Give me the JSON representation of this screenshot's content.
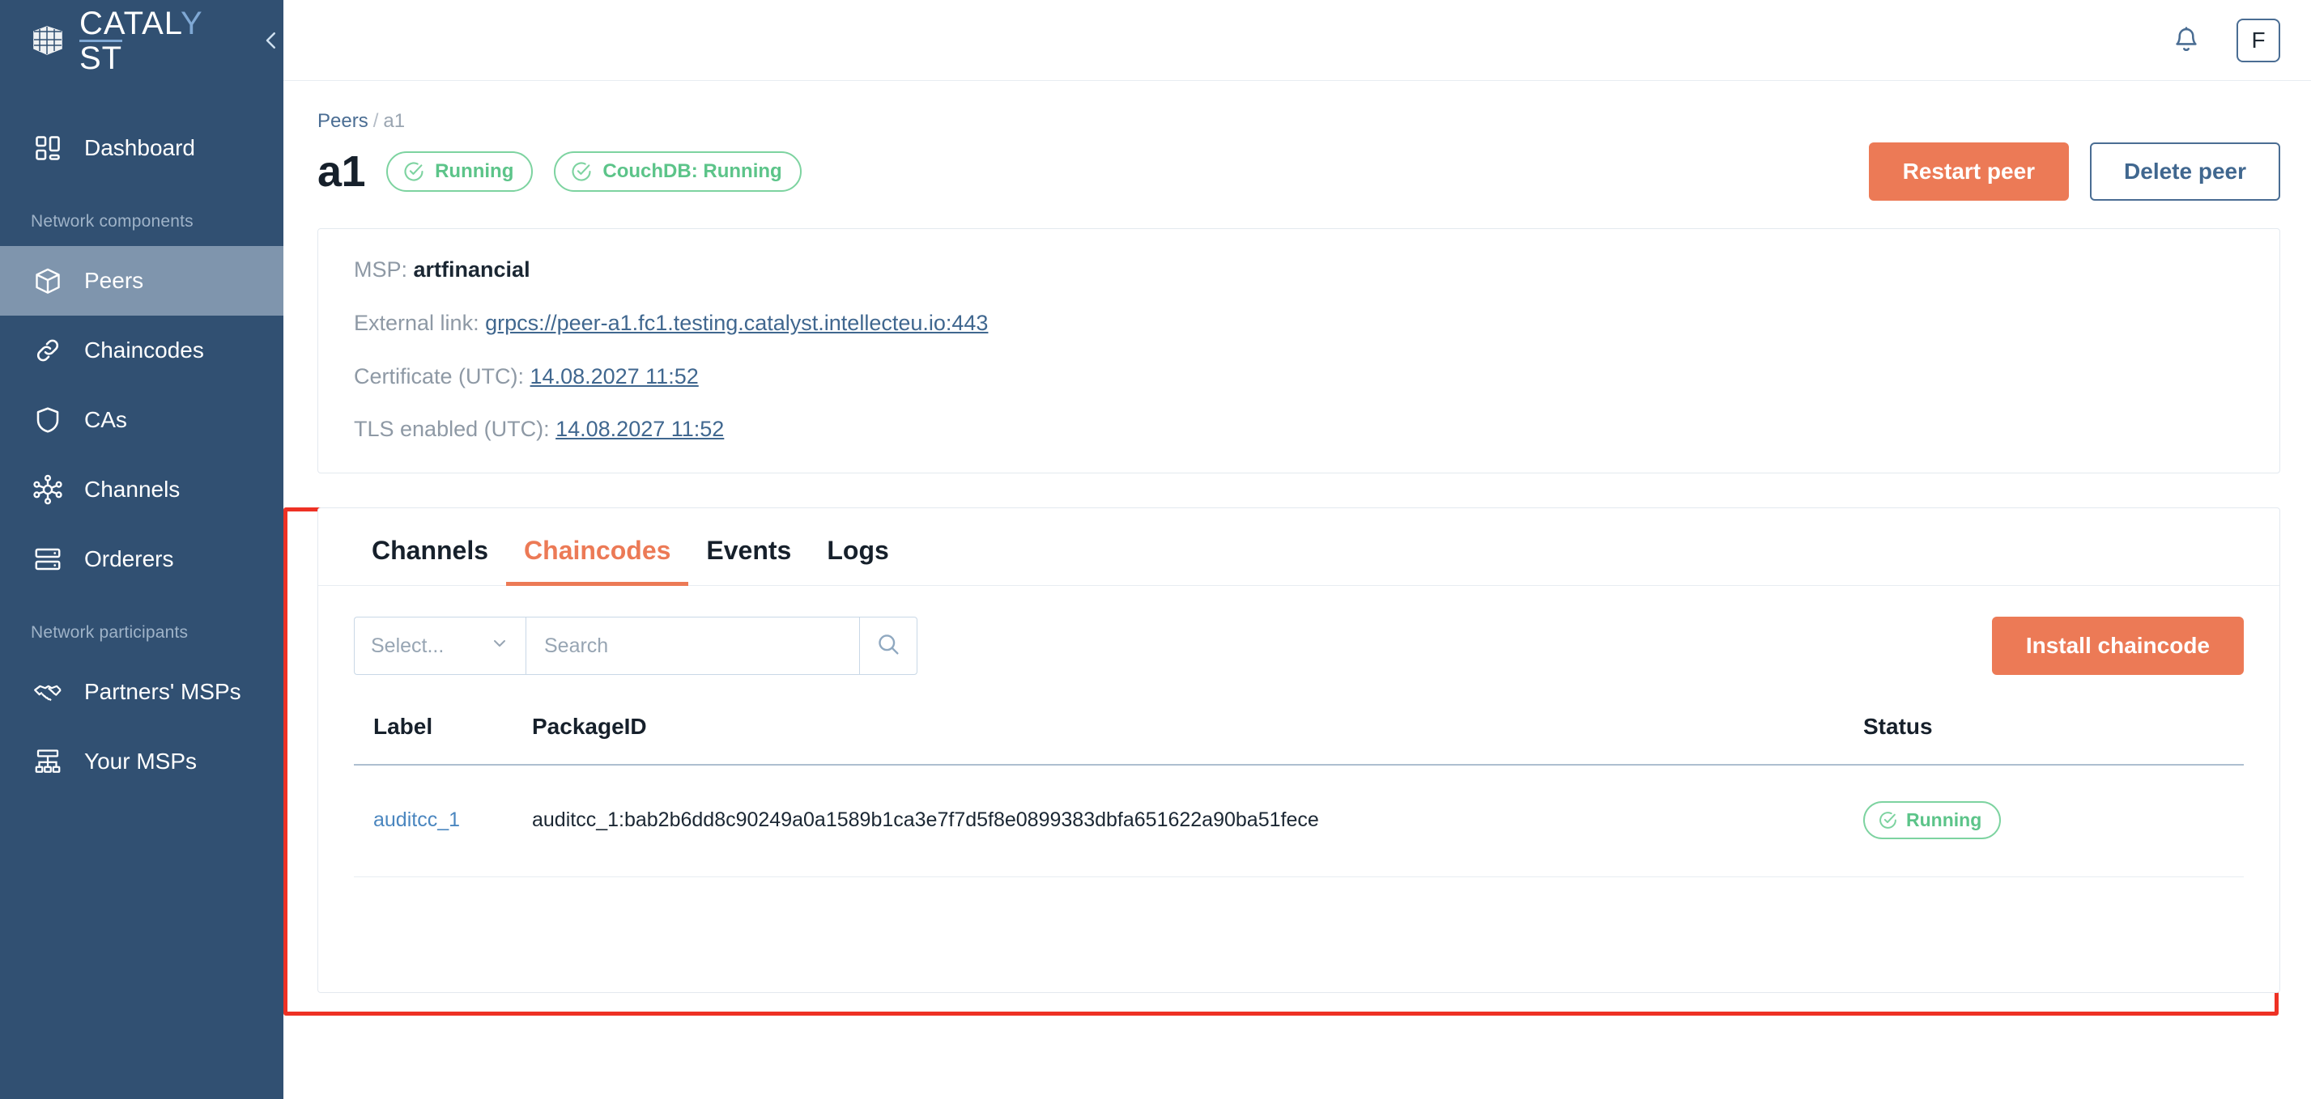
{
  "brand": {
    "name_prefix": "CATAL",
    "name_accent": "Y",
    "name_suffix": "ST",
    "logo_icon": "cube-grid-icon",
    "collapse_icon": "chevron-left-icon"
  },
  "sidebar": {
    "items": [
      {
        "label": "Dashboard",
        "icon": "dashboard-grid-icon",
        "active": false
      }
    ],
    "groups": [
      {
        "caption": "Network components",
        "items": [
          {
            "label": "Peers",
            "icon": "cube-icon",
            "active": true
          },
          {
            "label": "Chaincodes",
            "icon": "link-icon",
            "active": false
          },
          {
            "label": "CAs",
            "icon": "shield-icon",
            "active": false
          },
          {
            "label": "Channels",
            "icon": "network-hub-icon",
            "active": false
          },
          {
            "label": "Orderers",
            "icon": "server-icon",
            "active": false
          }
        ]
      },
      {
        "caption": "Network participants",
        "items": [
          {
            "label": "Partners' MSPs",
            "icon": "handshake-icon",
            "active": false
          },
          {
            "label": "Your MSPs",
            "icon": "org-chart-icon",
            "active": false
          }
        ]
      }
    ]
  },
  "topbar": {
    "notifications_icon": "bell-icon",
    "avatar_initial": "F"
  },
  "breadcrumb": {
    "parent": "Peers",
    "separator": "/",
    "current": "a1"
  },
  "header": {
    "title": "a1",
    "badges": [
      {
        "label": "Running",
        "icon": "check-circle-icon"
      },
      {
        "label": "CouchDB: Running",
        "icon": "check-circle-icon"
      }
    ],
    "restart_label": "Restart peer",
    "delete_label": "Delete peer"
  },
  "info": {
    "msp_label": "MSP:",
    "msp_value": "artfinancial",
    "external_link_label": "External link:",
    "external_link_value": "grpcs://peer-a1.fc1.testing.catalyst.intellecteu.io:443",
    "certificate_label": "Certificate (UTC):",
    "certificate_value": "14.08.2027 11:52",
    "tls_label": "TLS enabled (UTC):",
    "tls_value": "14.08.2027 11:52"
  },
  "panel": {
    "tabs": [
      {
        "label": "Channels",
        "active": false
      },
      {
        "label": "Chaincodes",
        "active": true
      },
      {
        "label": "Events",
        "active": false
      },
      {
        "label": "Logs",
        "active": false
      }
    ],
    "filter": {
      "select_placeholder": "Select...",
      "select_value": "",
      "chevron_icon": "chevron-down-icon",
      "search_placeholder": "Search",
      "search_value": "",
      "search_icon": "search-icon"
    },
    "install_label": "Install chaincode",
    "table": {
      "columns": [
        "Label",
        "PackageID",
        "Status"
      ],
      "rows": [
        {
          "label": "auditcc_1",
          "package_id": "auditcc_1:bab2b6dd8c90249a0a1589b1ca3e7f7d5f8e0899383dbfa651622a90ba51fece",
          "status": "Running",
          "status_icon": "check-circle-icon"
        }
      ]
    }
  },
  "colors": {
    "sidebar_bg": "#315072",
    "sidebar_active": "#7f95ad",
    "accent_orange": "#ec7a56",
    "link_blue": "#40678f",
    "status_green": "#5cc489",
    "annotation_red": "#ee3124"
  }
}
